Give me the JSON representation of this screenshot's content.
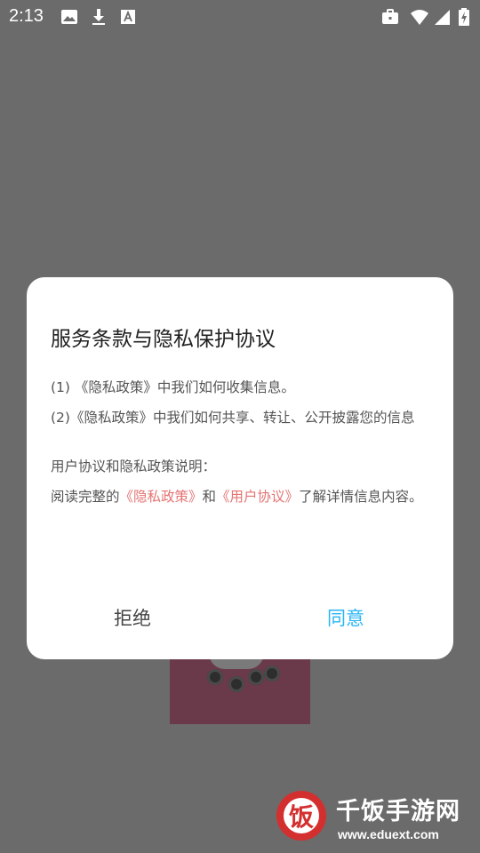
{
  "status_bar": {
    "time": "2:13",
    "icons": [
      "image-icon",
      "download-icon",
      "font-a-icon",
      "briefcase-icon",
      "wifi-icon",
      "cellular-signal-icon",
      "battery-charging-icon"
    ]
  },
  "dialog": {
    "title": "服务条款与隐私保护协议",
    "items": [
      "(1) 《隐私政策》中我们如何收集信息。",
      "(2)《隐私政策》中我们如何共享、转让、公开披露您的信息"
    ],
    "section_heading": "用户协议和隐私政策说明：",
    "read_prefix": "阅读完整的",
    "privacy_link": "《隐私政策》",
    "conjunction": "和",
    "user_agreement_link": "《用户协议》",
    "read_suffix": "了解详情信息内容。",
    "reject_label": "拒绝",
    "agree_label": "同意",
    "link_color": "#e57373",
    "agree_color": "#29b6f6"
  },
  "watermark": {
    "logo_char": "饭",
    "title": "千饭手游网",
    "url": "www.eduext.com"
  }
}
